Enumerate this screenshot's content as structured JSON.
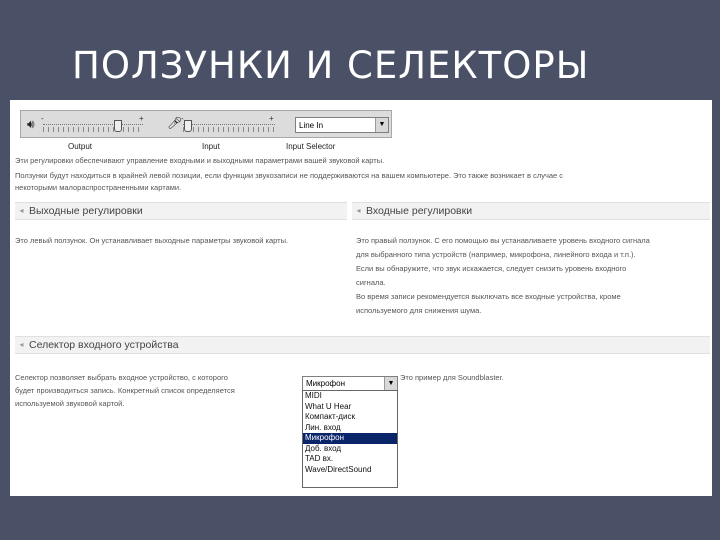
{
  "slide": {
    "title": "ПОЛЗУНКИ И СЕЛЕКТОРЫ"
  },
  "toolbar": {
    "output_label": "Output",
    "input_label": "Input",
    "input_selector_label": "Input Selector",
    "selector_value": "Line In",
    "plus": "+",
    "minus": "-",
    "output_level": 0.75,
    "input_level": 0.05
  },
  "intro": {
    "line1": "Эти регулировки обеспечивают управление входными и выходными параметрами вашей звуковой карты.",
    "line2": "Ползунки будут находиться в крайней левой позиции, если функции звукозаписи не поддерживаются на вашем компьютере. Это также возникает в случае с",
    "line3": "некоторыми малораспространенными картами."
  },
  "output_section": {
    "title": "Выходные регулировки",
    "text": "Это левый ползунок. Он устанавливает выходные параметры звуковой карты."
  },
  "input_section": {
    "title": "Входные регулировки",
    "line1": "Это правый ползунок. С его помощью вы устанавливаете уровень входного сигнала",
    "line2": "для выбранного типа устройств (например, микрофона, линейного входа и т.п.).",
    "line3": "Если вы обнаружите, что звук искажается, следует снизить уровень входного",
    "line4": "сигнала.",
    "line5": "Во время записи рекомендуется выключать все входные устройства, кроме",
    "line6": "используемого для снижения шума."
  },
  "selector_section": {
    "title": "Селектор входного устройства",
    "line1": "Селектор позволяет выбрать входное устройство, с которого",
    "line2": "будет производиться запись. Конкретный список определяется",
    "line3": "используемой звуковой картой.",
    "example_note": "Это пример для Soundblaster.",
    "select_value": "Микрофон",
    "options": [
      "MIDI",
      "What U Hear",
      "Компакт-диск",
      "Лин. вход",
      "Микрофон",
      "Доб. вход",
      "TAD вх.",
      "Wave/DirectSound"
    ],
    "selected_index": 4
  }
}
